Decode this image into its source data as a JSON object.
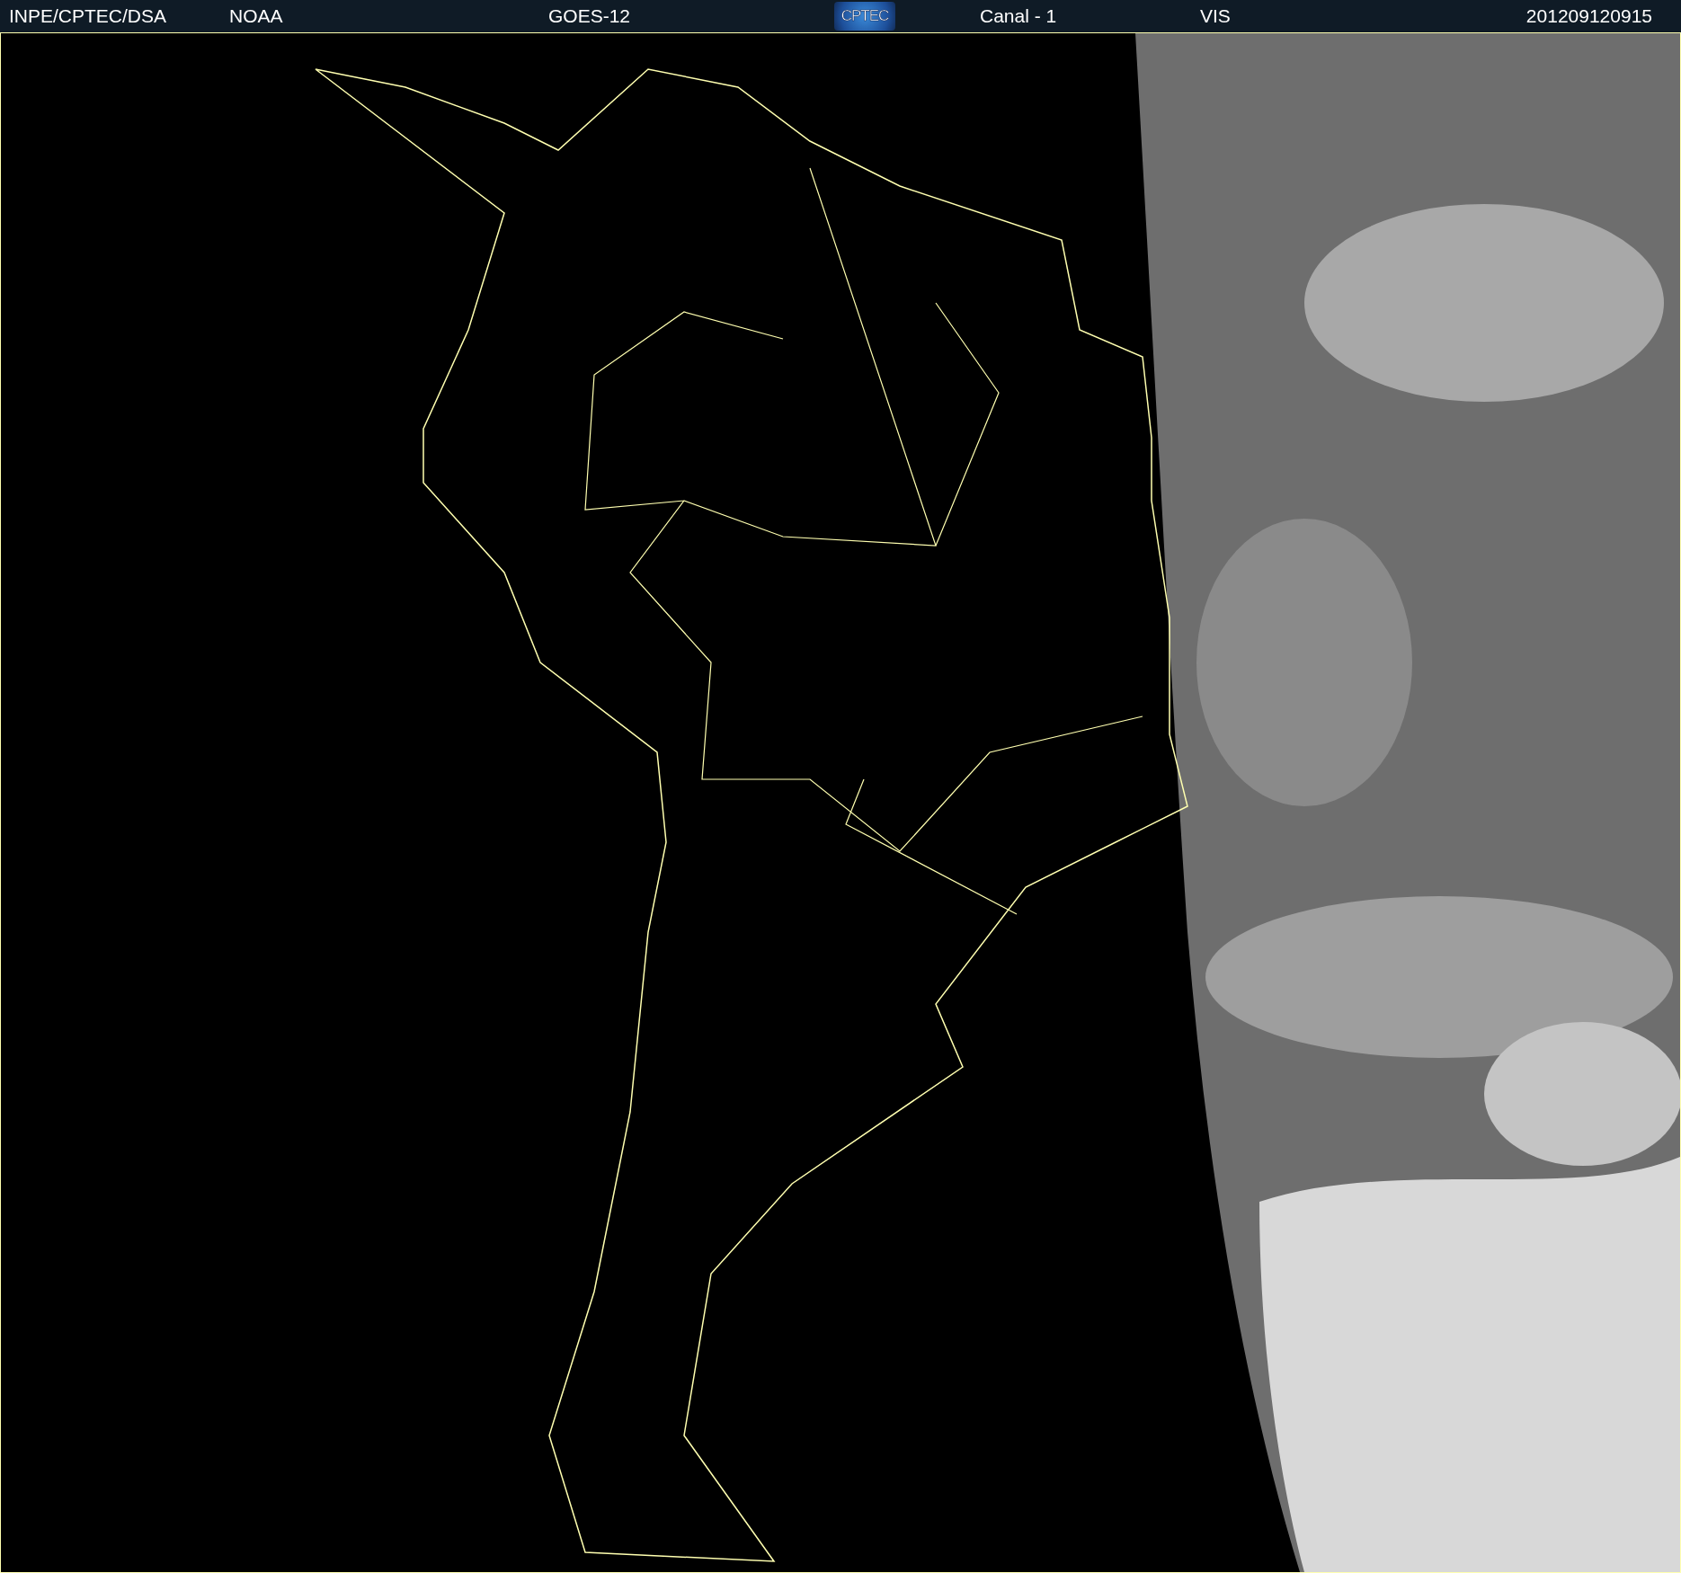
{
  "header": {
    "items": [
      {
        "kind": "text",
        "text": "INPE/CPTEC/DSA"
      },
      {
        "kind": "text",
        "text": "NOAA"
      },
      {
        "kind": "text",
        "text": "GOES-12"
      },
      {
        "kind": "logo",
        "text": "CPTEC"
      },
      {
        "kind": "text",
        "text": "Canal - 1"
      },
      {
        "kind": "text",
        "text": "VIS"
      },
      {
        "kind": "text",
        "text": "201209120915"
      }
    ]
  }
}
